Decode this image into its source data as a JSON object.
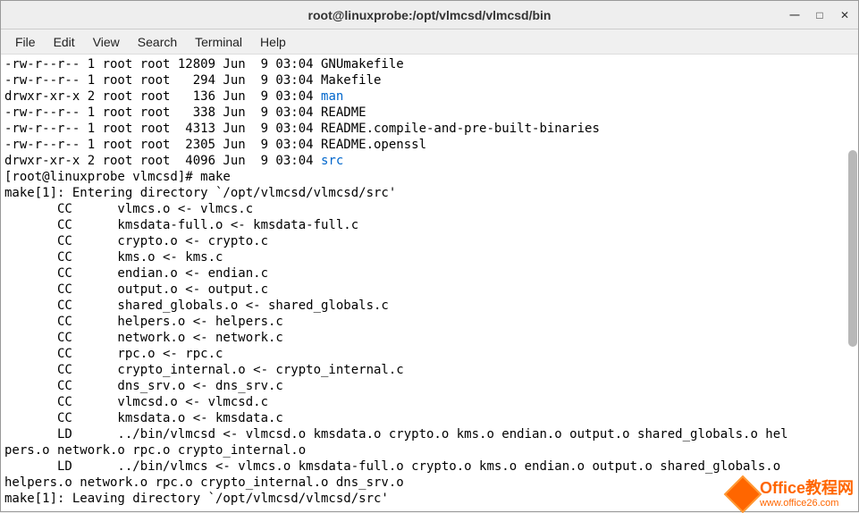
{
  "window": {
    "title": "root@linuxprobe:/opt/vlmcsd/vlmcsd/bin"
  },
  "menu": {
    "file": "File",
    "edit": "Edit",
    "view": "View",
    "search": "Search",
    "terminal": "Terminal",
    "help": "Help"
  },
  "lines": {
    "l0a": "-rw-r--r-- 1 root root 12809 Jun  9 03:04 GNUmakefile",
    "l1a": "-rw-r--r-- 1 root root   294 Jun  9 03:04 Makefile",
    "l2a": "drwxr-xr-x 2 root root   136 Jun  9 03:04 ",
    "l2b": "man",
    "l3a": "-rw-r--r-- 1 root root   338 Jun  9 03:04 README",
    "l4a": "-rw-r--r-- 1 root root  4313 Jun  9 03:04 README.compile-and-pre-built-binaries",
    "l5a": "-rw-r--r-- 1 root root  2305 Jun  9 03:04 README.openssl",
    "l6a": "drwxr-xr-x 2 root root  4096 Jun  9 03:04 ",
    "l6b": "src",
    "l7a": "[root@linuxprobe vlmcsd]# make",
    "l8a": "make[1]: Entering directory `/opt/vlmcsd/vlmcsd/src'",
    "l9a": "       CC      vlmcs.o <- vlmcs.c",
    "l10a": "       CC      kmsdata-full.o <- kmsdata-full.c",
    "l11a": "       CC      crypto.o <- crypto.c",
    "l12a": "       CC      kms.o <- kms.c",
    "l13a": "       CC      endian.o <- endian.c",
    "l14a": "       CC      output.o <- output.c",
    "l15a": "       CC      shared_globals.o <- shared_globals.c",
    "l16a": "       CC      helpers.o <- helpers.c",
    "l17a": "       CC      network.o <- network.c",
    "l18a": "       CC      rpc.o <- rpc.c",
    "l19a": "       CC      crypto_internal.o <- crypto_internal.c",
    "l20a": "       CC      dns_srv.o <- dns_srv.c",
    "l21a": "       CC      vlmcsd.o <- vlmcsd.c",
    "l22a": "       CC      kmsdata.o <- kmsdata.c",
    "l23a": "       LD      ../bin/vlmcsd <- vlmcsd.o kmsdata.o crypto.o kms.o endian.o output.o shared_globals.o hel",
    "l24a": "pers.o network.o rpc.o crypto_internal.o",
    "l25a": "       LD      ../bin/vlmcs <- vlmcs.o kmsdata-full.o crypto.o kms.o endian.o output.o shared_globals.o ",
    "l26a": "helpers.o network.o rpc.o crypto_internal.o dns_srv.o",
    "l27a": "make[1]: Leaving directory `/opt/vlmcsd/vlmcsd/src'"
  },
  "watermark": {
    "main": "Office教程网",
    "sub": "www.office26.com"
  }
}
